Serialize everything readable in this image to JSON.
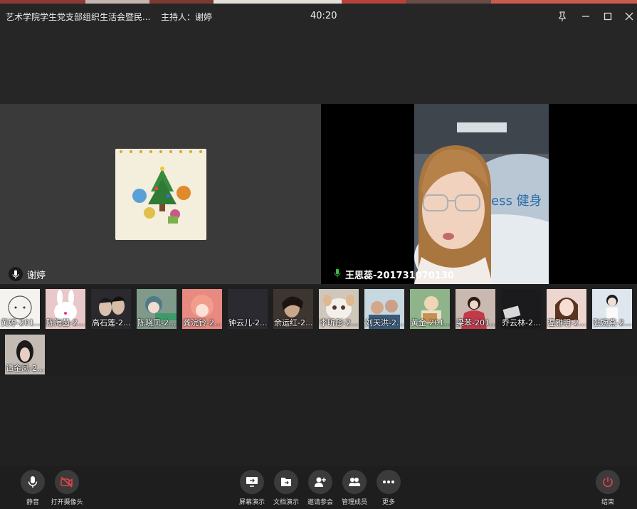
{
  "window": {
    "title": "艺术学院学生党支部组织生活会暨民...",
    "host_label": "主持人：",
    "host_name": "谢婷",
    "timer": "40:20"
  },
  "main_speaker": {
    "name": "谢婷"
  },
  "video_speaker": {
    "name": "王思蕊-201731070130",
    "bg_text": "ess 健身"
  },
  "participants": [
    {
      "label": "黄婷-201...",
      "color": "#f5f3f0"
    },
    {
      "label": "陈海茵-2...",
      "color": "#e8c8c8"
    },
    {
      "label": "高石莲-2...",
      "color": "#2a2a2e"
    },
    {
      "label": "陈晓凤-2...",
      "color": "#7f9a8a"
    },
    {
      "label": "龚浣铃-2...",
      "color": "#e88a80"
    },
    {
      "label": "钟云儿-2...",
      "color": "#2a2a30"
    },
    {
      "label": "余运红-2...",
      "color": "#3d3530"
    },
    {
      "label": "李昕彤-2...",
      "color": "#cfc7bc"
    },
    {
      "label": "刘天洪-2...",
      "color": "#c8d8e0"
    },
    {
      "label": "黄金-201...",
      "color": "#8fb48a"
    },
    {
      "label": "梁苯-201...",
      "color": "#c9b9b0"
    },
    {
      "label": "乔云林-2...",
      "color": "#1b1b1d"
    },
    {
      "label": "温雅明-2...",
      "color": "#ecd6cf"
    },
    {
      "label": "张婉燕-2...",
      "color": "#dfe6ee"
    },
    {
      "label": "谭金凤-2...",
      "color": "#c4bcb4"
    }
  ],
  "toolbar": {
    "mute": "静音",
    "camera": "打开摄像头",
    "screen_share": "屏幕演示",
    "doc_share": "文档演示",
    "invite": "邀请参会",
    "manage": "管理成员",
    "more": "更多",
    "end": "结束"
  },
  "colors": {
    "mic_active": "#3fbf3f",
    "camera_off": "#e0434d",
    "end_red": "#e8404a"
  }
}
